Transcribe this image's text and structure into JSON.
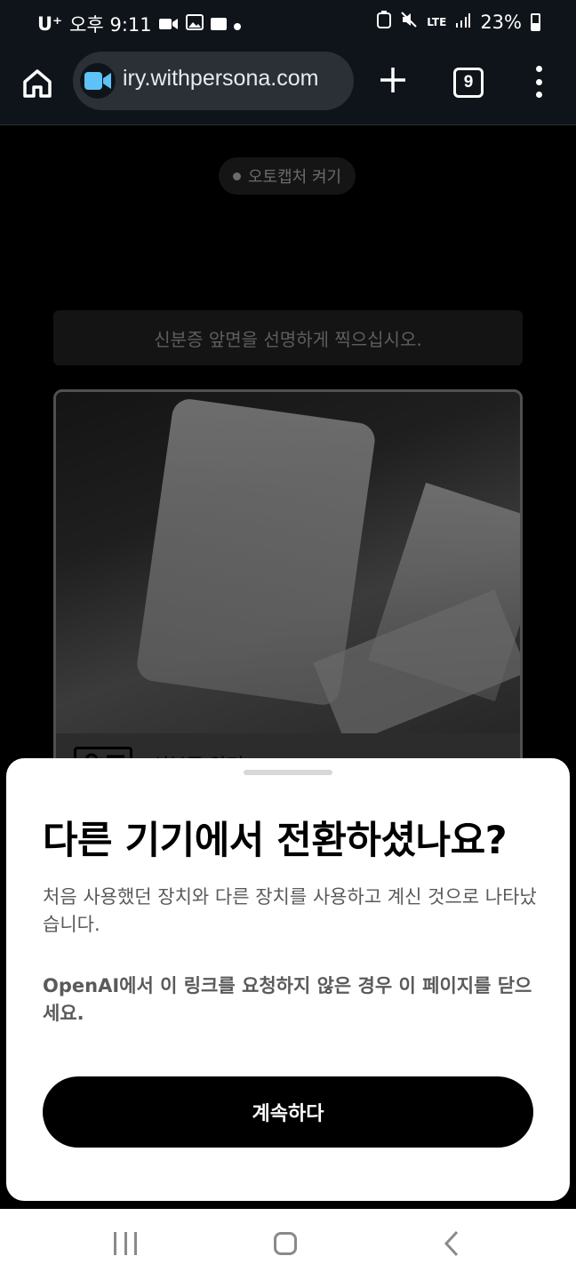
{
  "status_bar": {
    "carrier": "U⁺",
    "time": "오후 9:11",
    "network": "LTE",
    "battery": "23%"
  },
  "browser": {
    "url": "iry.withpersona.com",
    "tab_count": "9"
  },
  "page": {
    "auto_capture_label": "오토캡처 켜기",
    "instruction": "신분증 앞면을 선명하게 찍으십시오.",
    "document_label": "신분증 앞면"
  },
  "sheet": {
    "title": "다른 기기에서 전환하셨나요?",
    "description": "처음 사용했던 장치와 다른 장치를 사용하고 계신 것으로 나타났습니다.",
    "warning": "OpenAI에서 이 링크를 요청하지 않은 경우 이 페이지를 닫으세요.",
    "continue_label": "계속하다"
  },
  "icons": {
    "home": "home-icon",
    "site": "video-camera-icon",
    "new_tab": "plus-icon",
    "menu": "more-vert-icon",
    "id_card": "id-card-icon"
  },
  "colors": {
    "toolbar_bg": "#0e1419",
    "site_icon": "#5ec2f7",
    "button_bg": "#000000"
  }
}
